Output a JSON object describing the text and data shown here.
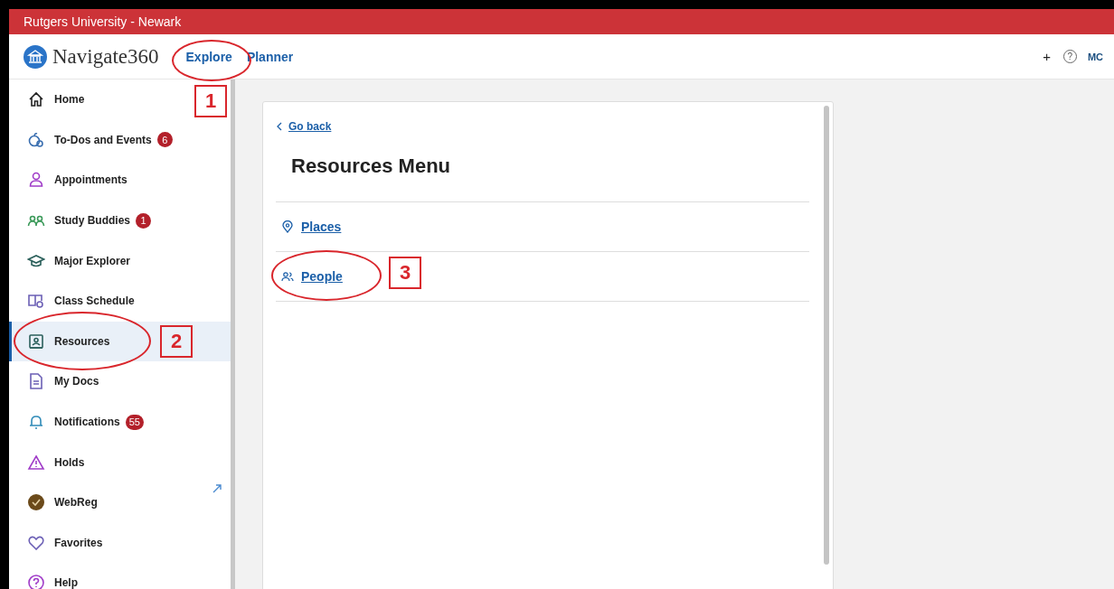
{
  "title_bar": {
    "title": "Rutgers University - Newark"
  },
  "header": {
    "logo_text": "Navigate360",
    "nav": [
      {
        "label": "Explore"
      },
      {
        "label": "Planner"
      }
    ],
    "add": "+",
    "help": "?",
    "user_initials": "MC"
  },
  "sidebar": {
    "items": [
      {
        "label": "Home",
        "selected": false
      },
      {
        "label": "To-Dos and Events",
        "badge": "6",
        "selected": false
      },
      {
        "label": "Appointments",
        "selected": false
      },
      {
        "label": "Study Buddies",
        "badge": "1",
        "selected": false
      },
      {
        "label": "Major Explorer",
        "selected": false
      },
      {
        "label": "Class Schedule",
        "selected": false
      },
      {
        "label": "Resources",
        "selected": true
      },
      {
        "label": "My Docs",
        "selected": false
      },
      {
        "label": "Notifications",
        "badge": "55",
        "selected": false
      },
      {
        "label": "Holds",
        "selected": false
      },
      {
        "label": "WebReg",
        "external": true,
        "selected": false
      },
      {
        "label": "Favorites",
        "selected": false
      },
      {
        "label": "Help",
        "selected": false
      }
    ]
  },
  "card": {
    "back": "Go back",
    "title": "Resources Menu",
    "links": [
      {
        "label": "Places"
      },
      {
        "label": "People"
      }
    ]
  },
  "annotations": [
    {
      "label": "1"
    },
    {
      "label": "2"
    },
    {
      "label": "3"
    }
  ]
}
